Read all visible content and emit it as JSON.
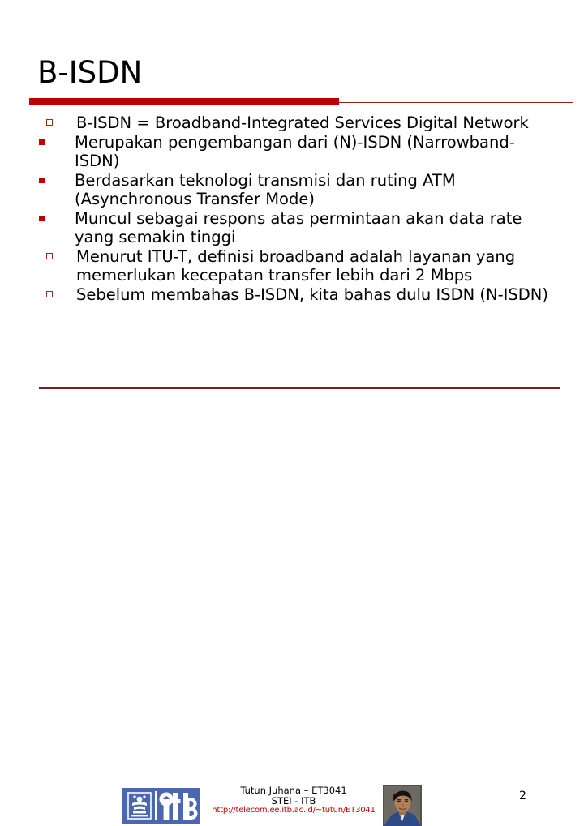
{
  "slide": {
    "title": "B-ISDN",
    "page_number": "2",
    "accent_color": "#c00000",
    "rule_color": "#9c1c13",
    "text_color": "#000000"
  },
  "content": {
    "bullets": [
      {
        "level": 1,
        "marker": "hollow-square-bullet",
        "text": "B-ISDN = Broadband-Integrated Services Digital Network",
        "children": [
          {
            "level": 2,
            "marker": "filled-square-bullet",
            "text": "Merupakan pengembangan dari (N)-ISDN (Narrowband-ISDN)"
          },
          {
            "level": 2,
            "marker": "filled-square-bullet",
            "text": "Berdasarkan teknologi transmisi dan ruting ATM (Asynchronous Transfer Mode)"
          },
          {
            "level": 2,
            "marker": "filled-square-bullet",
            "text": "Muncul sebagai respons atas permintaan akan data rate yang semakin tinggi"
          }
        ]
      },
      {
        "level": 1,
        "marker": "hollow-square-bullet",
        "text": "Menurut ITU-T, definisi broadband adalah layanan yang memerlukan kecepatan transfer lebih dari 2 Mbps",
        "children": []
      },
      {
        "level": 1,
        "marker": "hollow-square-bullet",
        "text": "Sebelum membahas B-ISDN, kita bahas dulu ISDN (N‑ISDN)",
        "children": []
      }
    ]
  },
  "footer": {
    "logo_alt": "itb-logo",
    "logo_color": "#4a68b0",
    "author": "Tutun Juhana – ET3041",
    "organization": "STEI - ITB",
    "url": "http://telecom.ee.itb.ac.id/~tutun/ET3041",
    "url_color": "#c00000",
    "portrait_alt": "author-portrait-photo"
  }
}
